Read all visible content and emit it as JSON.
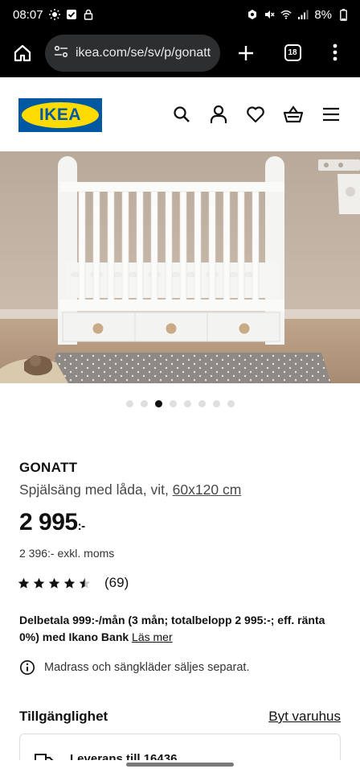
{
  "status_bar": {
    "time": "08:07",
    "battery": "8%"
  },
  "browser": {
    "url": "ikea.com/se/sv/p/gonatt",
    "tab_count": "18"
  },
  "site": {
    "logo_text": "IKEA",
    "brand_colors": {
      "blue": "#0058a3",
      "yellow": "#ffdb00"
    }
  },
  "header_icons": [
    "search-icon",
    "account-icon",
    "heart-icon",
    "cart-icon",
    "menu-icon"
  ],
  "gallery": {
    "dot_count": 8,
    "active_index": 2
  },
  "product": {
    "name": "GONATT",
    "description": "Spjälsäng med låda, vit, ",
    "size": "60x120 cm",
    "price": "2 995",
    "price_suffix": ":-",
    "price_ex_vat": "2 396:- exkl. moms",
    "rating_value": 4.5,
    "rating_max": 5,
    "review_count": "(69)",
    "financing": "Delbetala 999:-/mån (3 mån; totalbelopp 2 995:-; eff. ränta 0%) med Ikano Bank",
    "financing_link": "Läs mer",
    "notice": "Madrass och sängkläder säljes separat."
  },
  "availability": {
    "title": "Tillgänglighet",
    "change_store": "Byt varuhus",
    "delivery": "Leverans till 16436"
  }
}
